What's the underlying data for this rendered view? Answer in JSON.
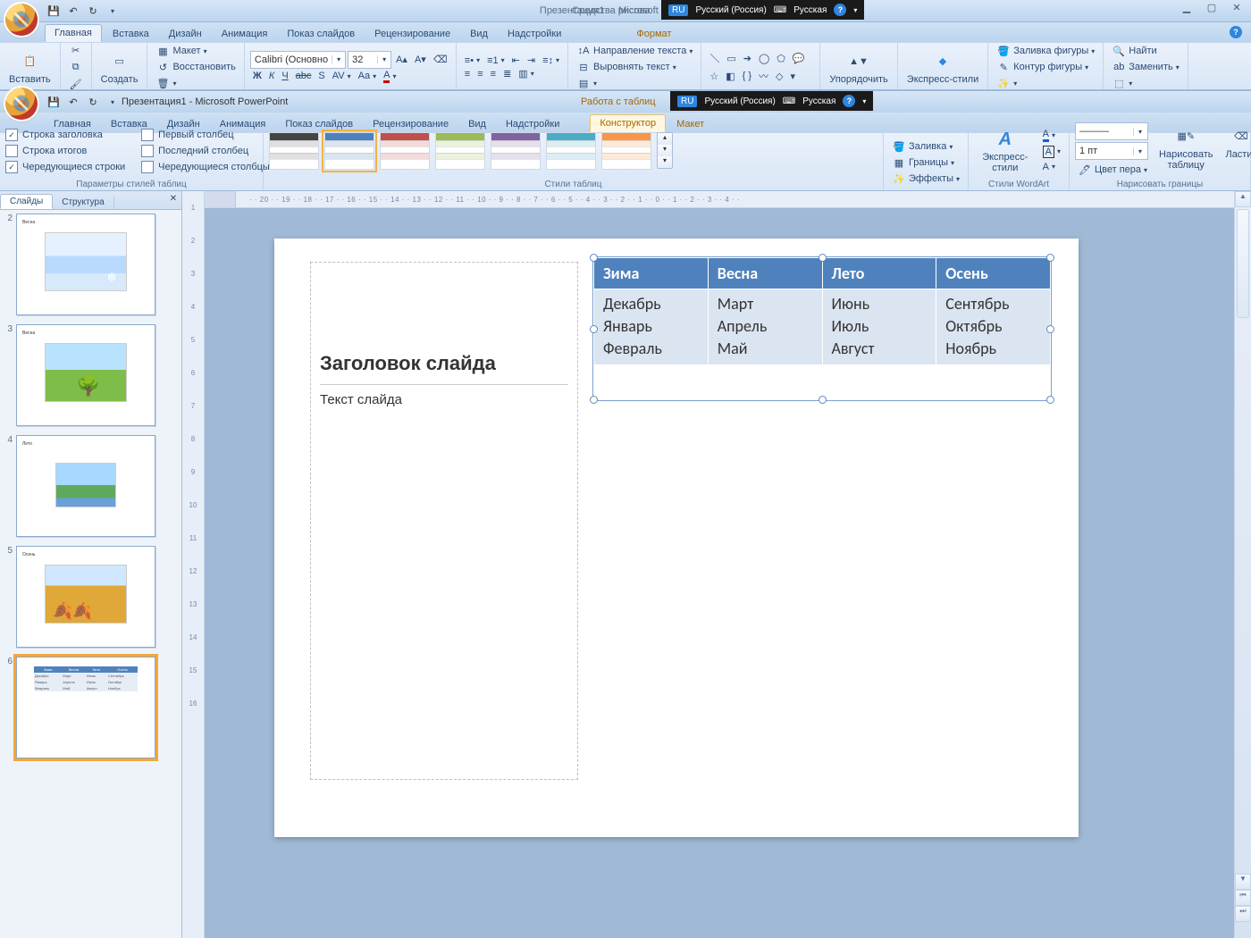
{
  "app": {
    "title_doc": "Презентация1",
    "title_app": "Microsoft PowerPoint",
    "context_title": "Средства рисова",
    "table_tools_title": "Работа с таблиц"
  },
  "langbar": {
    "code": "RU",
    "lang": "Русский (Россия)",
    "kbd_icon": "⌨",
    "kbd": "Русская"
  },
  "tabs_outer": [
    "Главная",
    "Вставка",
    "Дизайн",
    "Анимация",
    "Показ слайдов",
    "Рецензирование",
    "Вид",
    "Надстройки"
  ],
  "tabs_outer_ctx": "Формат",
  "tabs_inner": [
    "Главная",
    "Вставка",
    "Дизайн",
    "Анимация",
    "Показ слайдов",
    "Рецензирование",
    "Вид",
    "Надстройки"
  ],
  "tabs_inner_ctx": [
    "Конструктор",
    "Макет"
  ],
  "ribbon_a": {
    "paste": "Вставить",
    "create": "Создать",
    "layout": "Макет",
    "restore": "Восстановить",
    "font_name": "Calibri (Основно",
    "font_size": "32",
    "text_dir": "Направление текста",
    "align_text": "Выровнять текст",
    "arrange": "Упорядочить",
    "quick_styles": "Экспресс-стили",
    "shape_fill": "Заливка фигуры",
    "shape_outline": "Контур фигуры",
    "find": "Найти",
    "replace": "Заменить"
  },
  "ribbon_b": {
    "group_opts": "Параметры стилей таблиц",
    "group_styles": "Стили таблиц",
    "group_wordart": "Стили WordArt",
    "group_border": "Нарисовать границы",
    "opts": {
      "header_row": "Строка заголовка",
      "total_row": "Строка итогов",
      "banded_rows": "Чередующиеся строки",
      "first_col": "Первый столбец",
      "last_col": "Последний столбец",
      "banded_cols": "Чередующиеся столбцы"
    },
    "fill": "Заливка",
    "borders": "Границы",
    "effects": "Эффекты",
    "quick_styles": "Экспресс-стили",
    "pen_weight": "1 пт",
    "pen_color": "Цвет пера",
    "draw_table": "Нарисовать\nтаблицу",
    "eraser": "Ластик"
  },
  "slides_pane": {
    "tab_slides": "Слайды",
    "tab_outline": "Структура"
  },
  "thumbs": {
    "2": "Весна",
    "3": "Весна",
    "4": "Лето",
    "5": "Осень"
  },
  "slide": {
    "title_ph": "Заголовок слайда",
    "text_ph": "Текст слайда",
    "headers": [
      "Зима",
      "Весна",
      "Лето",
      "Осень"
    ],
    "rows": [
      [
        "Декабрь",
        "Март",
        "Июнь",
        "Сентябрь"
      ],
      [
        "Январь",
        "Апрель",
        "Июль",
        "Октябрь"
      ],
      [
        "Февраль",
        "Май",
        "Август",
        "Ноябрь"
      ]
    ]
  },
  "hruler_ticks": "·  · 20 ·  · 19 ·  · 18 ·  · 17 ·  · 16 ·  · 15 ·  · 14 ·  · 13 ·  · 12 ·  · 11 ·  · 10 ·  · 9 ·  · 8 ·  · 7 ·  · 6 ·  · 5 ·  · 4 ·  · 3 ·  · 2 ·  · 1 ·  · 0 ·  · 1 ·  · 2 ·  · 3 ·  · 4 ·  ·",
  "vruler_ticks": [
    "1",
    "2",
    "3",
    "4",
    "5",
    "6",
    "7",
    "8",
    "9",
    "10",
    "11",
    "12",
    "13",
    "14",
    "15",
    "16"
  ],
  "style_swatches": [
    {
      "hdr": "#444444",
      "row": "#e0e0e0"
    },
    {
      "hdr": "#4f81bd",
      "row": "#dbe5f1",
      "sel": true
    },
    {
      "hdr": "#c0504d",
      "row": "#f2dcdb"
    },
    {
      "hdr": "#9bbb59",
      "row": "#eaf1dd"
    },
    {
      "hdr": "#8064a2",
      "row": "#e5e0ec"
    },
    {
      "hdr": "#4bacc6",
      "row": "#dbeef3"
    },
    {
      "hdr": "#f79646",
      "row": "#fde9d9"
    }
  ]
}
